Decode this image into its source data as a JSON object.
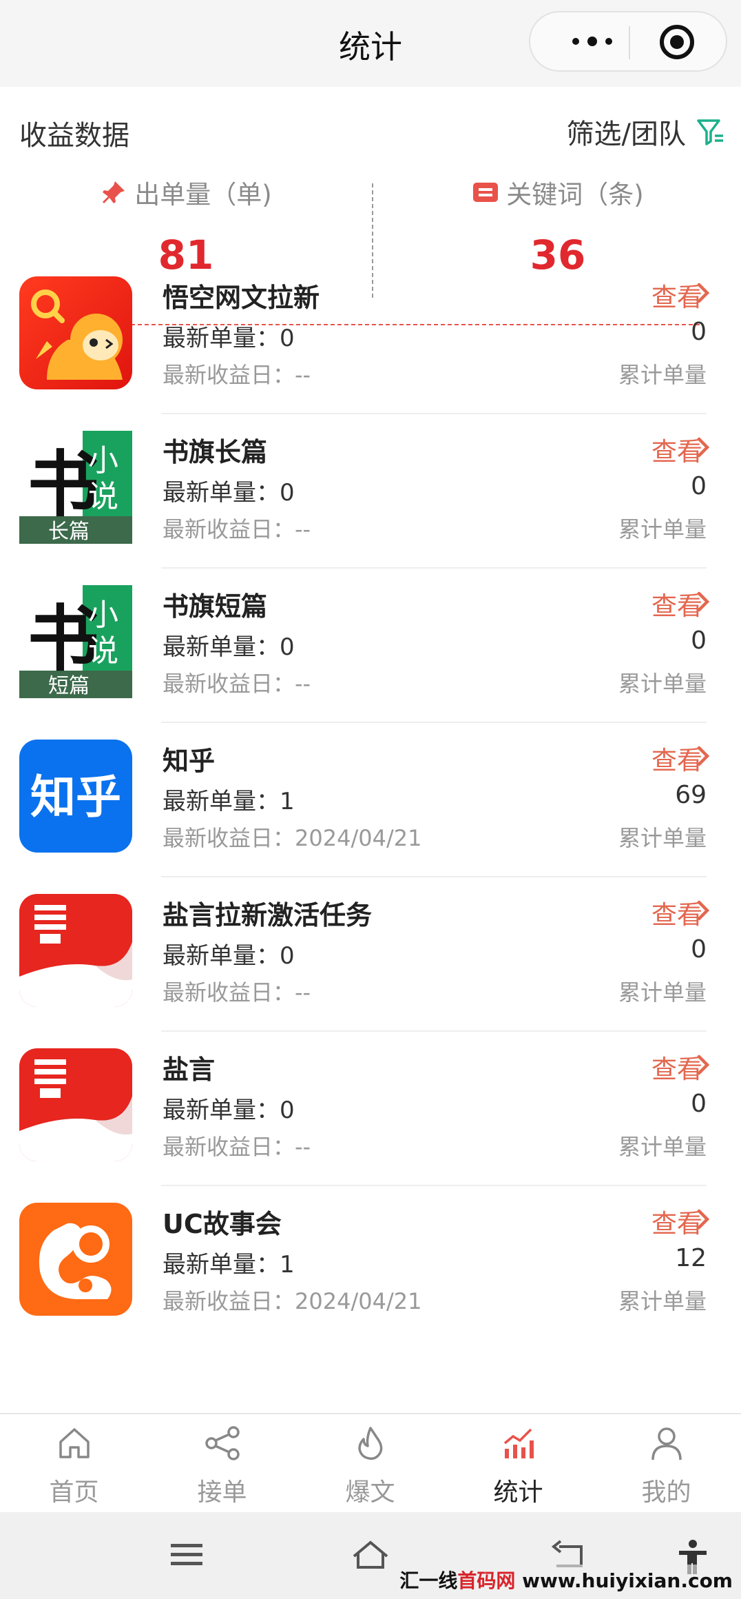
{
  "header": {
    "title": "统计"
  },
  "summary": {
    "section_title": "收益数据",
    "filter_label": "筛选/团队",
    "orders_label": "出单量（单)",
    "orders_value": "81",
    "keywords_label": "关键词（条)",
    "keywords_value": "36"
  },
  "items": [
    {
      "name": "悟空网文拉新",
      "latest": "最新单量：0",
      "date": "最新收益日：--",
      "view": "查看",
      "total": "0",
      "total_label": "累计单量"
    },
    {
      "name": "书旗长篇",
      "latest": "最新单量：0",
      "date": "最新收益日：--",
      "view": "查看",
      "total": "0",
      "total_label": "累计单量",
      "icon_big": "书",
      "icon_side": "小说",
      "icon_tag": "长篇"
    },
    {
      "name": "书旗短篇",
      "latest": "最新单量：0",
      "date": "最新收益日：--",
      "view": "查看",
      "total": "0",
      "total_label": "累计单量",
      "icon_big": "书",
      "icon_side": "小说",
      "icon_tag": "短篇"
    },
    {
      "name": "知乎",
      "latest": "最新单量：1",
      "date": "最新收益日：2024/04/21",
      "view": "查看",
      "total": "69",
      "total_label": "累计单量",
      "icon_text": "知乎"
    },
    {
      "name": "盐言拉新激活任务",
      "latest": "最新单量：0",
      "date": "最新收益日：--",
      "view": "查看",
      "total": "0",
      "total_label": "累计单量"
    },
    {
      "name": "盐言",
      "latest": "最新单量：0",
      "date": "最新收益日：--",
      "view": "查看",
      "total": "0",
      "total_label": "累计单量"
    },
    {
      "name": "UC故事会",
      "latest": "最新单量：1",
      "date": "最新收益日：2024/04/21",
      "view": "查看",
      "total": "12",
      "total_label": "累计单量"
    }
  ],
  "tabs": [
    {
      "label": "首页",
      "icon": "home-icon"
    },
    {
      "label": "接单",
      "icon": "share-icon"
    },
    {
      "label": "爆文",
      "icon": "flame-icon"
    },
    {
      "label": "统计",
      "icon": "chart-icon",
      "active": true
    },
    {
      "label": "我的",
      "icon": "user-icon"
    }
  ],
  "watermark": {
    "prefix": "汇一线",
    "em": "首码网",
    "suffix": " www.huiyixian.com"
  },
  "colors": {
    "accent_red": "#e0282e",
    "link_orange": "#e3674f",
    "filter_teal": "#1bb08c"
  }
}
